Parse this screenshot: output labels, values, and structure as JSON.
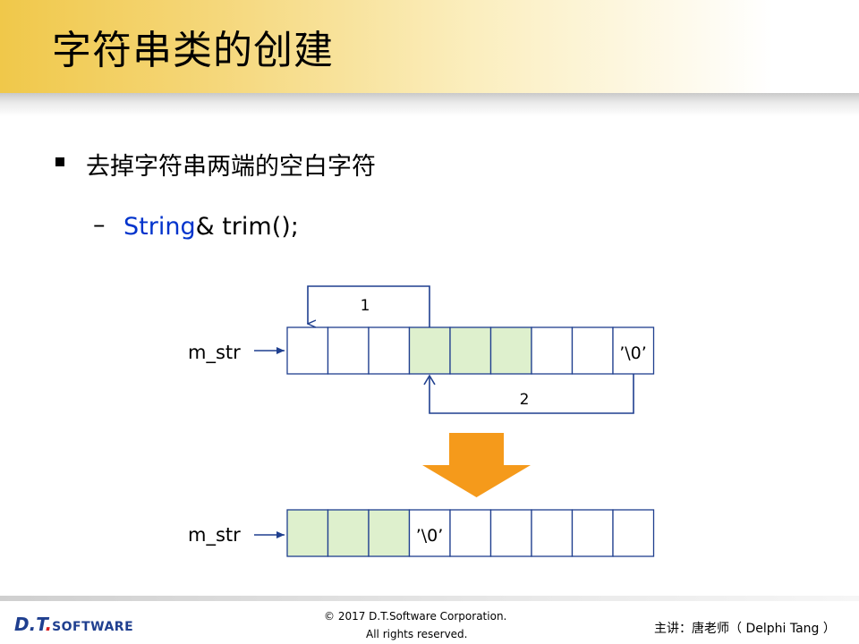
{
  "slide": {
    "title": "字符串类的创建",
    "bullet": "去掉字符串两端的空白字符",
    "dash": "–",
    "code_keyword": "String",
    "code_rest": "& trim();"
  },
  "diagram": {
    "top_label": "m_str",
    "bottom_label": "m_str",
    "arrow1_label": "1",
    "arrow2_label": "2",
    "null_char": "’\\0’",
    "top_cells_highlighted": [
      3,
      4,
      5
    ],
    "top_null_index": 8,
    "bottom_cells_highlighted": [
      0,
      1,
      2
    ],
    "bottom_null_index": 3,
    "cell_count": 9,
    "colors": {
      "highlight": "#def0cd",
      "arrow_blue": "#1f3f8f",
      "big_arrow": "#f59a1b"
    }
  },
  "footer": {
    "logo_dt": "D.T",
    "logo_dot": ".",
    "logo_software": "SOFTWARE",
    "copyright": "© 2017 D.T.Software Corporation.",
    "rights": "All rights reserved.",
    "lecturer": "主讲：唐老师（ Delphi Tang ）"
  }
}
